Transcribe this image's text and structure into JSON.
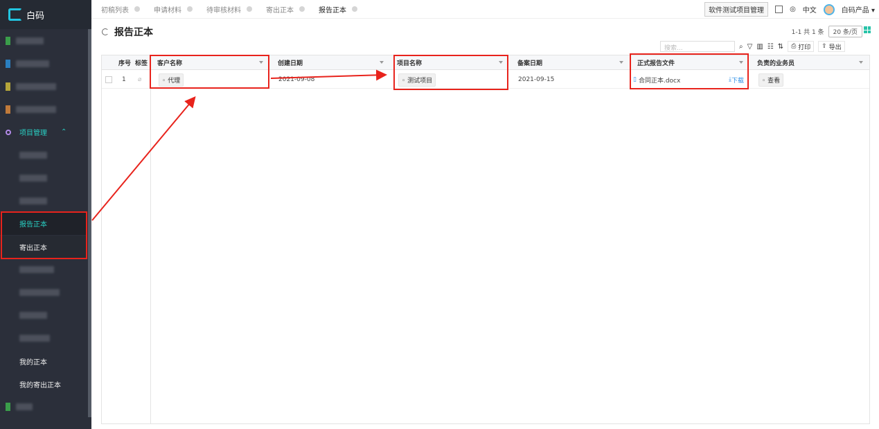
{
  "app": {
    "name": "白码"
  },
  "tabs": [
    "初稿列表",
    "申请材料",
    "待审核材料",
    "寄出正本",
    "报告正本"
  ],
  "topbar": {
    "project": "软件测试项目管理",
    "lang": "中文",
    "user": "白码产品 ▾"
  },
  "sidebar": {
    "project_mgmt": "项目管理",
    "items": [
      "报告正本",
      "寄出正本",
      "我的正本",
      "我的寄出正本"
    ]
  },
  "page": {
    "title": "报告正本"
  },
  "pager": {
    "text": "1-1 共 1 条",
    "size": "20 条/页"
  },
  "toolbar": {
    "search_placeholder": "搜索...",
    "print": "打印",
    "export": "导出"
  },
  "table": {
    "columns": [
      "序号",
      "标签",
      "客户名称",
      "创建日期",
      "项目名称",
      "备案日期",
      "正式报告文件",
      "负责的业务员"
    ],
    "rows": [
      {
        "index": "1",
        "customer": "代理",
        "created": "2021-09-08",
        "project": "测试项目",
        "filed": "2021-09-15",
        "file": "合同正本.docx",
        "download": "下载",
        "salesman": "查看"
      }
    ]
  },
  "colors": {
    "accent": "#29d0c4",
    "annotation": "#e8231c",
    "link": "#2c8fe6",
    "sidebar_bg": "#2b2f3a"
  }
}
